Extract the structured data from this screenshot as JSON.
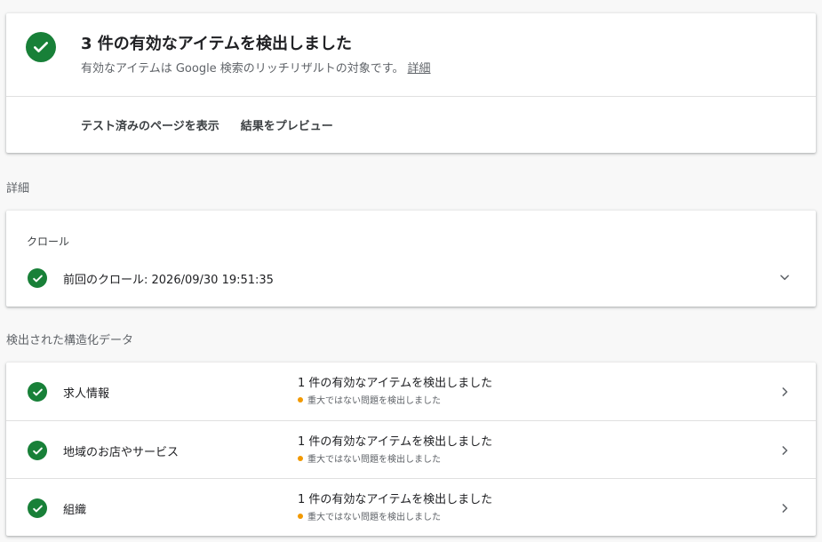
{
  "summary": {
    "title": "3 件の有効なアイテムを検出しました",
    "subtitle": "有効なアイテムは Google 検索のリッチリザルトの対象です。",
    "details_link": "詳細",
    "action_view_page": "テスト済みのページを表示",
    "action_preview": "結果をプレビュー"
  },
  "details_section_label": "詳細",
  "crawl": {
    "label": "クロール",
    "last_crawl": "前回のクロール: 2026/09/30 19:51:35"
  },
  "structured_data_section_label": "検出された構造化データ",
  "structured_data": [
    {
      "name": "求人情報",
      "status": "1 件の有効なアイテムを検出しました",
      "warning": "重大ではない問題を検出しました"
    },
    {
      "name": "地域のお店やサービス",
      "status": "1 件の有効なアイテムを検出しました",
      "warning": "重大ではない問題を検出しました"
    },
    {
      "name": "組織",
      "status": "1 件の有効なアイテムを検出しました",
      "warning": "重大ではない問題を検出しました"
    }
  ],
  "colors": {
    "success": "#188038",
    "warning": "#f29900"
  },
  "icons": {
    "success": "check-circle-icon",
    "expand": "chevron-down-icon",
    "navigate": "chevron-right-icon"
  }
}
